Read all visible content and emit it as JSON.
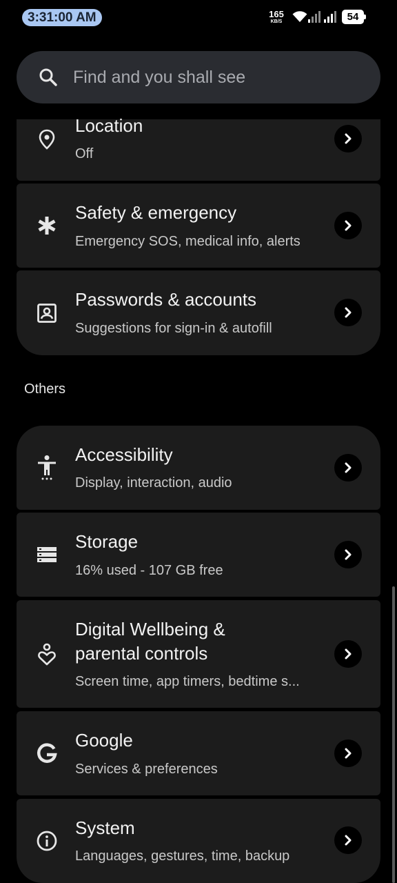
{
  "status_bar": {
    "time": "3:31:00 AM",
    "net_speed_value": "165",
    "net_speed_unit": "KB/S",
    "battery_level": "54"
  },
  "search": {
    "placeholder": "Find and you shall see"
  },
  "section_top": {
    "items": [
      {
        "title": "Location",
        "subtitle": "Off",
        "icon": "location-pin-icon"
      },
      {
        "title": "Safety & emergency",
        "subtitle": "Emergency SOS, medical info, alerts",
        "icon": "asterisk-icon"
      },
      {
        "title": "Passwords & accounts",
        "subtitle": "Suggestions for sign-in & autofill",
        "icon": "account-box-icon"
      }
    ]
  },
  "section_others": {
    "header": "Others",
    "items": [
      {
        "title": "Accessibility",
        "subtitle": "Display, interaction, audio",
        "icon": "accessibility-icon"
      },
      {
        "title": "Storage",
        "subtitle": "16% used - 107 GB free",
        "icon": "storage-icon"
      },
      {
        "title_line1": "Digital Wellbeing &",
        "title_line2": "parental controls",
        "subtitle": "Screen time, app timers, bedtime s...",
        "icon": "wellbeing-icon"
      },
      {
        "title": "Google",
        "subtitle": "Services & preferences",
        "icon": "google-g-icon"
      },
      {
        "title": "System",
        "subtitle": "Languages, gestures, time, backup",
        "icon": "info-icon"
      }
    ]
  },
  "colors": {
    "background": "#000000",
    "card": "#1c1c1c",
    "search_bar": "#2a2c31",
    "time_pill": "#a9c7f2"
  }
}
